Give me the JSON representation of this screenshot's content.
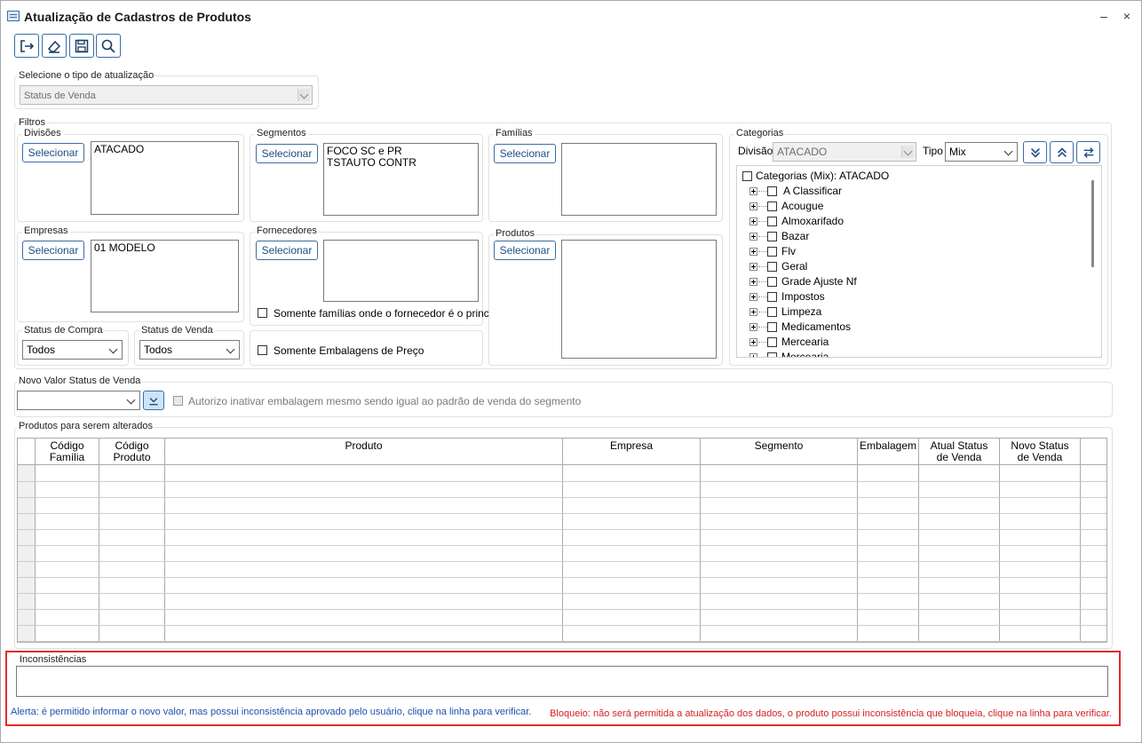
{
  "window": {
    "title": "Atualização de Cadastros de Produtos",
    "minimize_label": "–",
    "close_label": "×"
  },
  "toolbar": {
    "buttons": [
      {
        "icon": "exit-icon"
      },
      {
        "icon": "eraser-icon"
      },
      {
        "icon": "save-icon"
      },
      {
        "icon": "search-icon"
      }
    ]
  },
  "update_type": {
    "label": "Selecione o tipo de atualização",
    "value": "Status de Venda"
  },
  "filters": {
    "label": "Filtros",
    "divisoes": {
      "label": "Divisões",
      "button": "Selecionar",
      "items": [
        "ATACADO"
      ]
    },
    "segmentos": {
      "label": "Segmentos",
      "button": "Selecionar",
      "items": [
        "FOCO SC e PR",
        "TSTAUTO CONTR"
      ]
    },
    "familias": {
      "label": "Famílias",
      "button": "Selecionar",
      "items": []
    },
    "empresas": {
      "label": "Empresas",
      "button": "Selecionar",
      "items": [
        "01 MODELO"
      ]
    },
    "fornecedores": {
      "label": "Fornecedores",
      "button": "Selecionar",
      "items": []
    },
    "produtos": {
      "label": "Produtos",
      "button": "Selecionar",
      "items": []
    },
    "only_principal_label": "Somente famílias onde o fornecedor é o principal",
    "only_price_pack_label": "Somente Embalagens de Preço",
    "status_compra": {
      "label": "Status de Compra",
      "value": "Todos"
    },
    "status_venda": {
      "label": "Status de Venda",
      "value": "Todos"
    }
  },
  "categorias": {
    "label": "Categorias",
    "divisao_label": "Divisão",
    "divisao_value": "ATACADO",
    "tipo_label": "Tipo",
    "tipo_value": "Mix",
    "root": "Categorias (Mix): ATACADO",
    "items": [
      "A Classificar",
      "Acougue",
      "Almoxarifado",
      "Bazar",
      "Flv",
      "Geral",
      "Grade Ajuste Nf",
      "Impostos",
      "Limpeza",
      "Medicamentos",
      "Mercearia",
      "Mercearia"
    ]
  },
  "novo_valor": {
    "label": "Novo Valor Status de Venda",
    "value": "",
    "authorize_label": "Autorizo inativar embalagem mesmo sendo igual ao padrão de venda do segmento"
  },
  "products_grid": {
    "label": "Produtos para serem alterados",
    "columns": [
      {
        "line1": "Código",
        "line2": "Família"
      },
      {
        "line1": "Código",
        "line2": "Produto"
      },
      {
        "line1": "Produto",
        "line2": ""
      },
      {
        "line1": "Empresa",
        "line2": ""
      },
      {
        "line1": "Segmento",
        "line2": ""
      },
      {
        "line1": "Embalagem",
        "line2": ""
      },
      {
        "line1": "Atual Status",
        "line2": "de Venda"
      },
      {
        "line1": "Novo Status",
        "line2": "de Venda"
      }
    ]
  },
  "inconsistencias": {
    "label": "Inconsistências",
    "alert_text": "Alerta: é permitido informar o novo valor, mas possui inconsistência aprovado pelo usuário, clique na linha para verificar.",
    "block_text": "Bloqueio: não será permitida a atualização dos dados, o produto possui inconsistência que bloqueia, clique na linha para verificar.",
    "alert_color": "#1f4fb0",
    "block_color": "#d61f1f"
  }
}
